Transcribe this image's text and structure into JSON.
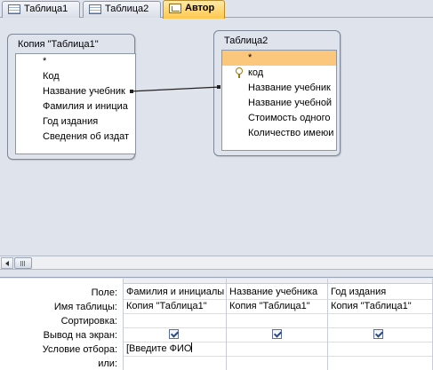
{
  "tabs": [
    {
      "label": "Таблица1",
      "icon": "table-icon"
    },
    {
      "label": "Таблица2",
      "icon": "table-icon"
    },
    {
      "label": "Автор",
      "icon": "query-icon",
      "active": true
    }
  ],
  "tables": {
    "left": {
      "title": "Копия \"Таблица1\"",
      "fields": [
        "*",
        "Код",
        "Название учебник",
        "Фамилия и инициа",
        "Год издания",
        "Сведения об издат"
      ]
    },
    "right": {
      "title": "Таблица2",
      "fields": [
        "*",
        "код",
        "Название учебник",
        "Название учебной",
        "Стоимость одного",
        "Количество имеюи"
      ]
    }
  },
  "grid": {
    "row_labels": [
      "Поле:",
      "Имя таблицы:",
      "Сортировка:",
      "Вывод на экран:",
      "Условие отбора:",
      "или:"
    ],
    "columns": [
      {
        "field": "Фамилия и инициалы",
        "table": "Копия \"Таблица1\"",
        "sort": "",
        "show": true,
        "criteria": "[Введите ФИО",
        "or": ""
      },
      {
        "field": "Название учебника",
        "table": "Копия \"Таблица1\"",
        "sort": "",
        "show": true,
        "criteria": "",
        "or": ""
      },
      {
        "field": "Год издания",
        "table": "Копия \"Таблица1\"",
        "sort": "",
        "show": true,
        "criteria": "",
        "or": ""
      }
    ]
  },
  "colors": {
    "selected_field": "#fbc77d",
    "active_tab": "#ffc74d",
    "background": "#dfe3ec"
  }
}
